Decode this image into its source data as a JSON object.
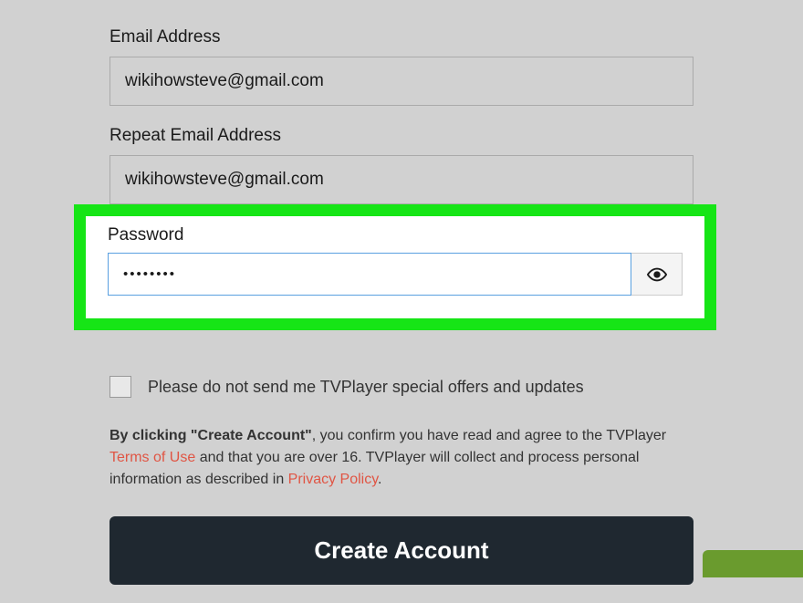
{
  "fields": {
    "email": {
      "label": "Email Address",
      "value": "wikihowsteve@gmail.com"
    },
    "repeat_email": {
      "label": "Repeat Email Address",
      "value": "wikihowsteve@gmail.com"
    },
    "password": {
      "label": "Password",
      "value": "••••••••"
    }
  },
  "opt_out": {
    "label": "Please do not send me TVPlayer special offers and updates"
  },
  "legal": {
    "prefix_bold": "By clicking \"Create Account\"",
    "part1": ", you confirm you have read and agree to the TVPlayer ",
    "terms_link": "Terms of Use",
    "part2": " and that you are over 16. TVPlayer will collect and process personal information as described in ",
    "privacy_link": "Privacy Policy",
    "part3": "."
  },
  "button": {
    "create": "Create Account"
  }
}
